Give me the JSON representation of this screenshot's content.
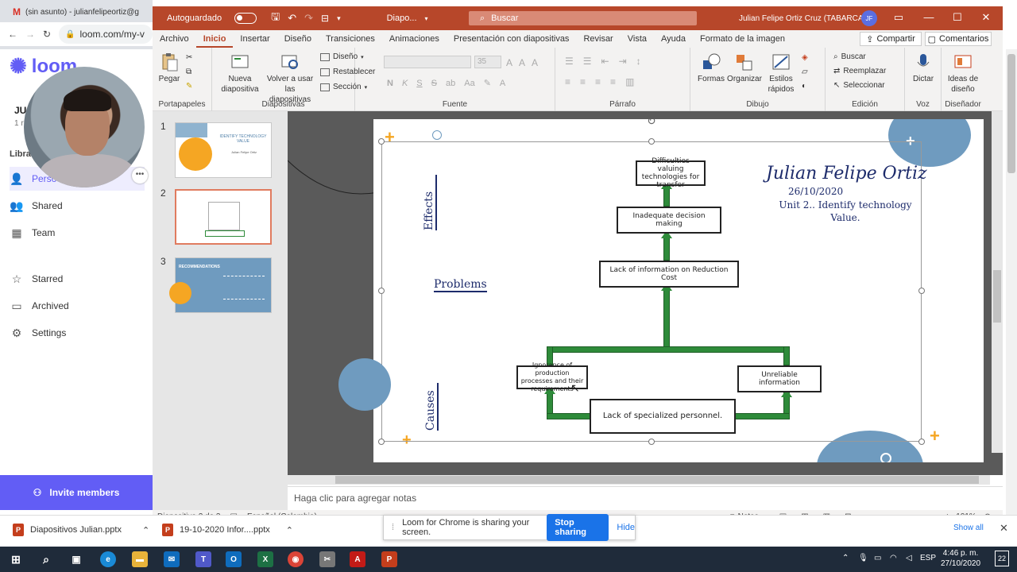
{
  "browser": {
    "tab_title": "(sin asunto) - julianfelipeortiz@g",
    "url": "loom.com/my-v"
  },
  "loom": {
    "logo": "loom",
    "library_label": "Libra",
    "workspace_initial": "JU",
    "workspace_sub": "1 r",
    "nav": [
      {
        "label": "Perso",
        "icon": "person-icon"
      },
      {
        "label": "Shared",
        "icon": "people-icon"
      },
      {
        "label": "Team",
        "icon": "building-icon"
      },
      {
        "label": "Starred",
        "icon": "star-icon"
      },
      {
        "label": "Archived",
        "icon": "archive-icon"
      },
      {
        "label": "Settings",
        "icon": "gear-icon"
      }
    ],
    "invite_label": "Invite members"
  },
  "ppt": {
    "autosave_label": "Autoguardado",
    "file_name": "Diapo...",
    "search_placeholder": "Buscar",
    "user_name": "Julian Felipe Ortiz Cruz (TABARCA)",
    "user_initials": "JF",
    "tabs": [
      "Archivo",
      "Inicio",
      "Insertar",
      "Diseño",
      "Transiciones",
      "Animaciones",
      "Presentación con diapositivas",
      "Revisar",
      "Vista",
      "Ayuda",
      "Formato de la imagen"
    ],
    "share_label": "Compartir",
    "comments_label": "Comentarios",
    "ribbon": {
      "paste": "Pegar",
      "clipboard_group": "Portapapeles",
      "new_slide": "Nueva diapositiva",
      "reuse_slides": "Volver a usar las diapositivas",
      "layout": "Diseño",
      "reset": "Restablecer",
      "section": "Sección",
      "slides_group": "Diapositivas",
      "font_size": "35",
      "font_group": "Fuente",
      "paragraph_group": "Párrafo",
      "shapes": "Formas",
      "arrange": "Organizar",
      "quick_styles": "Estilos rápidos",
      "drawing_group": "Dibujo",
      "find": "Buscar",
      "replace": "Reemplazar",
      "select": "Seleccionar",
      "editing_group": "Edición",
      "dictate": "Dictar",
      "voice_group": "Voz",
      "design_ideas": "Ideas de diseño",
      "designer_group": "Diseñador"
    },
    "thumbnails": [
      {
        "number": "1",
        "title": "IDENTIFY TECHNOLOGY VALUE",
        "subtitle": "Julian Felipe Ortiz"
      },
      {
        "number": "2"
      },
      {
        "number": "3",
        "title": "RECOMMENDATIONS"
      }
    ],
    "notes_placeholder": "Haga clic para agregar notas",
    "status": {
      "slide_info": "Diapositiva 2 de 3",
      "language": "Español (Colombia)",
      "notes": "Notas",
      "zoom": "101%"
    }
  },
  "slide": {
    "author": "Julian Felipe Ortiz",
    "date": "26/10/2020",
    "unit": "Unit 2.. Identify technology Value.",
    "effects_label": "Effects",
    "problems_label": "Problems",
    "causes_label": "Causes",
    "boxes": {
      "top": "Difficulties valuing technologies for transfer",
      "decision": "Inadequate decision making",
      "info": "Lack of information on Reduction Cost",
      "cause_left": "Ignorance of production processes and their requirements",
      "cause_right": "Unreliable information",
      "cause_bottom": "Lack of specialized personnel."
    }
  },
  "downloads": {
    "file1": "Diapositivos Julian.pptx",
    "file2": "19-10-2020 Infor....pptx",
    "show_all": "Show all"
  },
  "loom_notice": {
    "message": "Loom for Chrome is sharing your screen.",
    "stop": "Stop sharing",
    "hide": "Hide"
  },
  "taskbar": {
    "language": "ESP",
    "time": "4:46 p. m.",
    "date": "27/10/2020",
    "notifications": "22"
  },
  "colors": {
    "ppt_brand": "#b7472a",
    "loom_brand": "#625df5",
    "diagram_green": "#2e8b3a",
    "accent_orange": "#f5a623",
    "accent_blue": "#6f9bbf"
  }
}
